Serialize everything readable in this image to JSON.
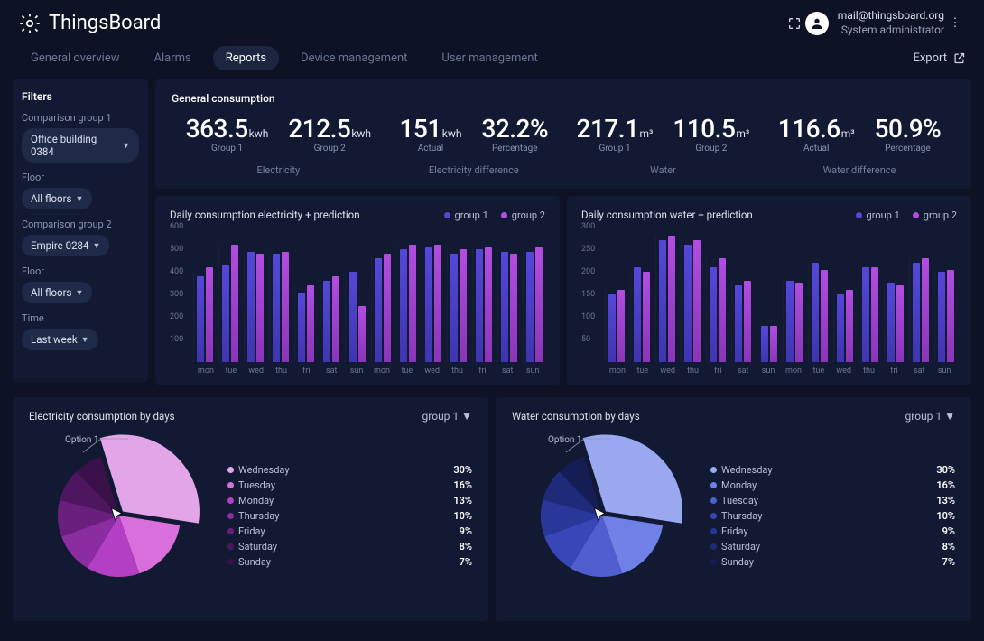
{
  "brand": "ThingsBoard",
  "user": {
    "email": "mail@thingsboard.org",
    "role": "System administrator"
  },
  "tabs": [
    "General overview",
    "Alarms",
    "Reports",
    "Device management",
    "User management"
  ],
  "active_tab": "Reports",
  "export_label": "Export",
  "filters": {
    "title": "Filters",
    "group1_label": "Comparison group 1",
    "group1_value": "Office building 0384",
    "floor_label": "Floor",
    "floor1_value": "All floors",
    "group2_label": "Comparison group 2",
    "group2_value": "Empire 0284",
    "floor2_value": "All floors",
    "time_label": "Time",
    "time_value": "Last week"
  },
  "gc": {
    "title": "General consumption",
    "electricity": {
      "g1": "363.5",
      "g2": "212.5",
      "unit": "kwh",
      "g1_label": "Group 1",
      "g2_label": "Group 2",
      "section": "Electricity"
    },
    "elec_diff": {
      "actual": "151",
      "unit": "kwh",
      "pct": "32.2%",
      "a_label": "Actual",
      "p_label": "Percentage",
      "section": "Electricity difference"
    },
    "water": {
      "g1": "217.1",
      "g2": "110.5",
      "unit": "m³",
      "g1_label": "Group 1",
      "g2_label": "Group 2",
      "section": "Water"
    },
    "water_diff": {
      "actual": "116.6",
      "unit": "m³",
      "pct": "50.9%",
      "a_label": "Actual",
      "p_label": "Percentage",
      "section": "Water difference"
    }
  },
  "legend_labels": {
    "g1": "group 1",
    "g2": "group 2"
  },
  "colors": {
    "g1": "#5548d9",
    "g2": "#b24de0",
    "blue1": "#5e6fe8",
    "blue2": "#3a4fc9"
  },
  "chart_data": [
    {
      "type": "bar",
      "title": "Daily consumption electricity + prediction",
      "ylim": [
        0,
        600
      ],
      "yticks": [
        100,
        200,
        300,
        400,
        500,
        600
      ],
      "categories": [
        "mon",
        "tue",
        "wed",
        "thu",
        "fri",
        "sat",
        "sun",
        "mon",
        "tue",
        "wed",
        "thu",
        "fri",
        "sat",
        "sun"
      ],
      "series": [
        {
          "name": "group 1",
          "values": [
            380,
            430,
            490,
            480,
            310,
            360,
            400,
            460,
            500,
            510,
            480,
            500,
            490,
            490
          ]
        },
        {
          "name": "group 2",
          "values": [
            420,
            520,
            480,
            490,
            340,
            380,
            250,
            480,
            520,
            520,
            500,
            510,
            480,
            510
          ]
        }
      ]
    },
    {
      "type": "bar",
      "title": "Daily consumption water + prediction",
      "ylim": [
        0,
        300
      ],
      "yticks": [
        50,
        100,
        150,
        200,
        250,
        300
      ],
      "categories": [
        "mon",
        "tue",
        "wed",
        "thu",
        "fri",
        "sat",
        "sun",
        "mon",
        "tue",
        "wed",
        "thu",
        "fri",
        "sat",
        "sun"
      ],
      "series": [
        {
          "name": "group 1",
          "values": [
            150,
            210,
            270,
            260,
            210,
            170,
            80,
            180,
            220,
            150,
            210,
            175,
            220,
            200
          ]
        },
        {
          "name": "group 2",
          "values": [
            160,
            200,
            280,
            270,
            230,
            180,
            80,
            175,
            205,
            160,
            210,
            170,
            230,
            205
          ]
        }
      ]
    },
    {
      "type": "pie",
      "title": "Electricity consumption by days",
      "selector": "group 1",
      "annotation": "Option 1",
      "palette": [
        "#e2a6e8",
        "#d96fdc",
        "#b23fc4",
        "#8b2ca0",
        "#6a1f7d",
        "#4f1660",
        "#3a1048"
      ],
      "series": [
        {
          "name": "group 1",
          "slices": [
            {
              "label": "Wednesday",
              "value": 30
            },
            {
              "label": "Tuesday",
              "value": 16
            },
            {
              "label": "Monday",
              "value": 13
            },
            {
              "label": "Thursday",
              "value": 10
            },
            {
              "label": "Friday",
              "value": 9
            },
            {
              "label": "Saturday",
              "value": 8
            },
            {
              "label": "Sunday",
              "value": 7
            }
          ]
        }
      ]
    },
    {
      "type": "pie",
      "title": "Water consumption by days",
      "selector": "group 1",
      "annotation": "Option 1",
      "palette": [
        "#9aa8f0",
        "#6f80e6",
        "#4f5fd0",
        "#3847b8",
        "#2a379a",
        "#1f2a78",
        "#151d55"
      ],
      "series": [
        {
          "name": "group 1",
          "slices": [
            {
              "label": "Wednesday",
              "value": 30
            },
            {
              "label": "Monday",
              "value": 16
            },
            {
              "label": "Tuesday",
              "value": 13
            },
            {
              "label": "Thursday",
              "value": 10
            },
            {
              "label": "Friday",
              "value": 9
            },
            {
              "label": "Saturday",
              "value": 8
            },
            {
              "label": "Sunday",
              "value": 7
            }
          ]
        }
      ]
    }
  ]
}
